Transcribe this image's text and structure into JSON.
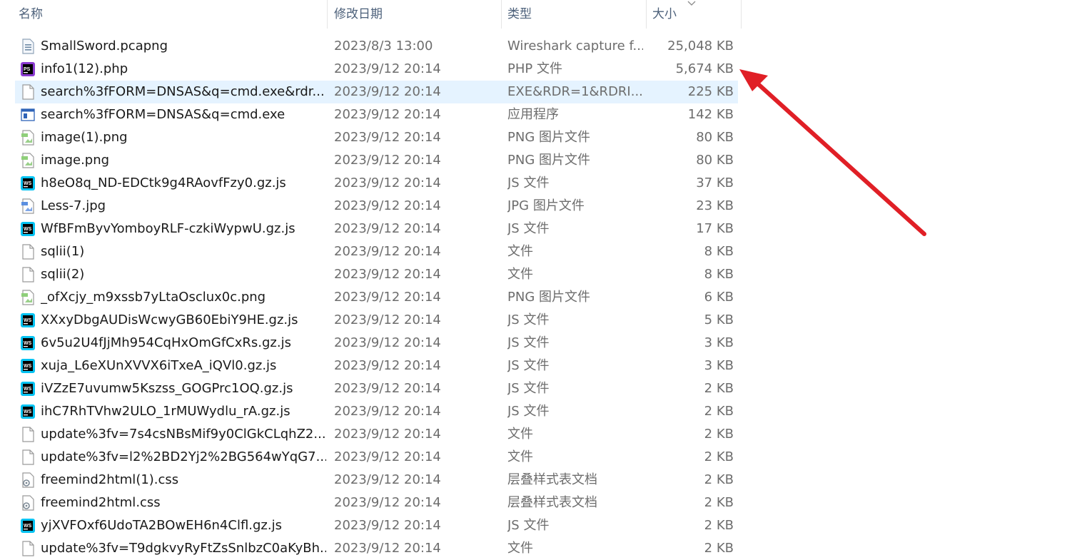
{
  "columns": {
    "name": "名称",
    "date": "修改日期",
    "type": "类型",
    "size": "大小"
  },
  "accent": {
    "selection": "#e5f3ff",
    "arrow": "#e01f26"
  },
  "files": [
    {
      "name": "SmallSword.pcapng",
      "date": "2023/8/3 13:00",
      "type": "Wireshark capture f...",
      "size": "25,048 KB",
      "icon": "pcap-icon"
    },
    {
      "name": "info1(12).php",
      "date": "2023/9/12 20:14",
      "type": "PHP 文件",
      "size": "5,674 KB",
      "icon": "phpstorm-icon"
    },
    {
      "name": "search%3fFORM=DNSAS&q=cmd.exe&rdr...",
      "date": "2023/9/12 20:14",
      "type": "EXE&RDR=1&RDRI...",
      "size": "225 KB",
      "icon": "blank-file-icon",
      "selected": true
    },
    {
      "name": "search%3fFORM=DNSAS&q=cmd.exe",
      "date": "2023/9/12 20:14",
      "type": "应用程序",
      "size": "142 KB",
      "icon": "exe-icon"
    },
    {
      "name": "image(1).png",
      "date": "2023/9/12 20:14",
      "type": "PNG 图片文件",
      "size": "80 KB",
      "icon": "png-icon"
    },
    {
      "name": "image.png",
      "date": "2023/9/12 20:14",
      "type": "PNG 图片文件",
      "size": "80 KB",
      "icon": "png-icon"
    },
    {
      "name": "h8eO8q_ND-EDCtk9g4RAovfFzy0.gz.js",
      "date": "2023/9/12 20:14",
      "type": "JS 文件",
      "size": "37 KB",
      "icon": "webstorm-icon"
    },
    {
      "name": "Less-7.jpg",
      "date": "2023/9/12 20:14",
      "type": "JPG 图片文件",
      "size": "23 KB",
      "icon": "jpg-icon"
    },
    {
      "name": "WfBFmByvYomboyRLF-czkiWypwU.gz.js",
      "date": "2023/9/12 20:14",
      "type": "JS 文件",
      "size": "17 KB",
      "icon": "webstorm-icon"
    },
    {
      "name": "sqlii(1)",
      "date": "2023/9/12 20:14",
      "type": "文件",
      "size": "8 KB",
      "icon": "blank-file-icon"
    },
    {
      "name": "sqlii(2)",
      "date": "2023/9/12 20:14",
      "type": "文件",
      "size": "8 KB",
      "icon": "blank-file-icon"
    },
    {
      "name": "_ofXcjy_m9xssb7yLtaOsclux0c.png",
      "date": "2023/9/12 20:14",
      "type": "PNG 图片文件",
      "size": "6 KB",
      "icon": "png-icon"
    },
    {
      "name": "XXxyDbgAUDisWcwyGB60EbiY9HE.gz.js",
      "date": "2023/9/12 20:14",
      "type": "JS 文件",
      "size": "5 KB",
      "icon": "webstorm-icon"
    },
    {
      "name": "6v5u2U4fJjMh954CqHxOmGfCxRs.gz.js",
      "date": "2023/9/12 20:14",
      "type": "JS 文件",
      "size": "3 KB",
      "icon": "webstorm-icon"
    },
    {
      "name": "xuja_L6eXUnXVVX6iTxeA_iQVl0.gz.js",
      "date": "2023/9/12 20:14",
      "type": "JS 文件",
      "size": "3 KB",
      "icon": "webstorm-icon"
    },
    {
      "name": "iVZzE7uvumw5Kszss_GOGPrc1OQ.gz.js",
      "date": "2023/9/12 20:14",
      "type": "JS 文件",
      "size": "2 KB",
      "icon": "webstorm-icon"
    },
    {
      "name": "ihC7RhTVhw2ULO_1rMUWydlu_rA.gz.js",
      "date": "2023/9/12 20:14",
      "type": "JS 文件",
      "size": "2 KB",
      "icon": "webstorm-icon"
    },
    {
      "name": "update%3fv=7s4csNBsMif9y0ClGkCLqhZ2...",
      "date": "2023/9/12 20:14",
      "type": "文件",
      "size": "2 KB",
      "icon": "blank-file-icon"
    },
    {
      "name": "update%3fv=l2%2BD2Yj2%2BG564wYqG7...",
      "date": "2023/9/12 20:14",
      "type": "文件",
      "size": "2 KB",
      "icon": "blank-file-icon"
    },
    {
      "name": "freemind2html(1).css",
      "date": "2023/9/12 20:14",
      "type": "层叠样式表文档",
      "size": "2 KB",
      "icon": "css-icon"
    },
    {
      "name": "freemind2html.css",
      "date": "2023/9/12 20:14",
      "type": "层叠样式表文档",
      "size": "2 KB",
      "icon": "css-icon"
    },
    {
      "name": "yjXVFOxf6UdoTA2BOwEH6n4Clfl.gz.js",
      "date": "2023/9/12 20:14",
      "type": "JS 文件",
      "size": "2 KB",
      "icon": "webstorm-icon"
    },
    {
      "name": "update%3fv=T9dgkvyRyFtZsSnlbzC0aKyBh...",
      "date": "2023/9/12 20:14",
      "type": "文件",
      "size": "2 KB",
      "icon": "blank-file-icon"
    }
  ]
}
